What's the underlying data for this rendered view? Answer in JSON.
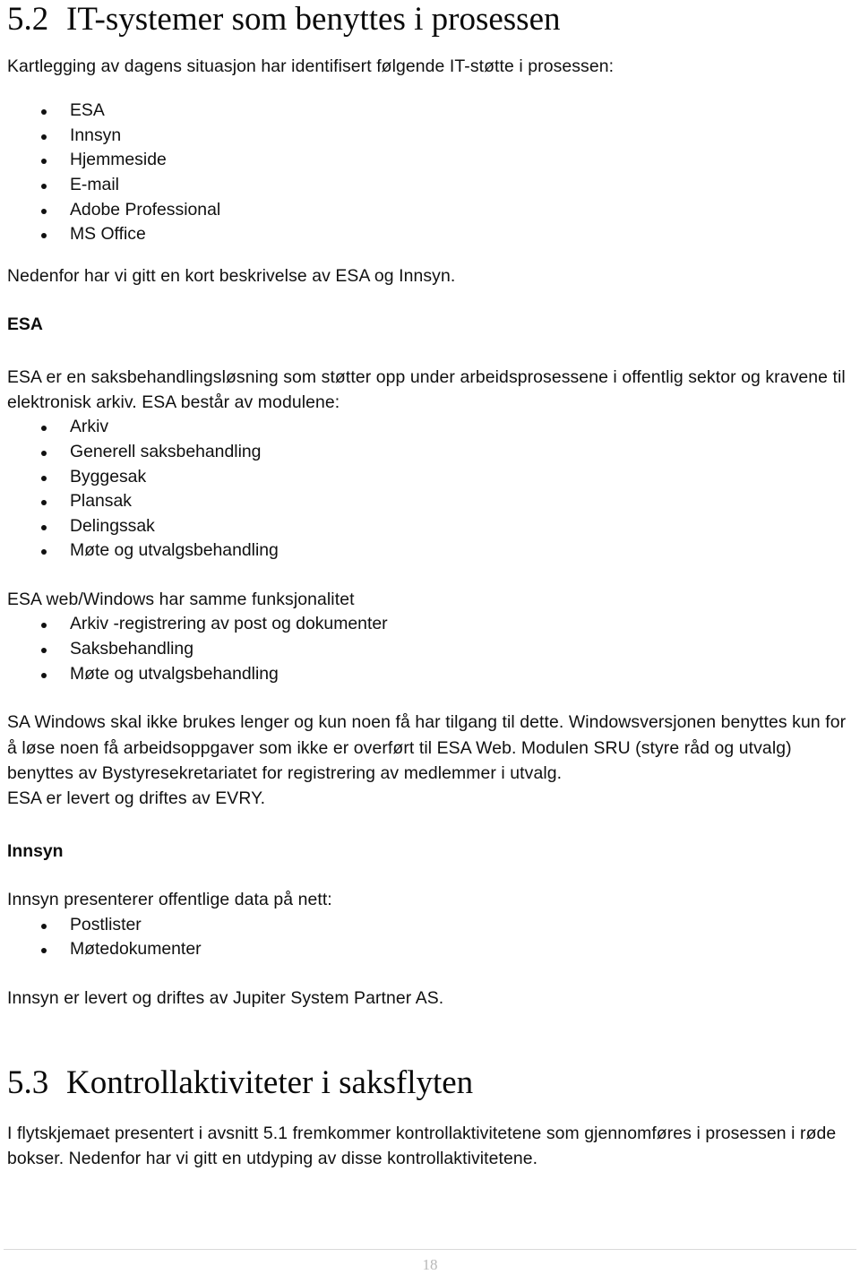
{
  "document": {
    "sections": [
      {
        "number": "5.2",
        "title": "IT-systemer som benyttes i prosessen",
        "intro": "Kartlegging av dagens situasjon har identifisert følgende IT-støtte i prosessen:",
        "systems": [
          "ESA",
          "Innsyn",
          "Hjemmeside",
          "E-mail",
          "Adobe Professional",
          "MS Office"
        ],
        "after_systems": "Nedenfor har vi gitt en kort beskrivelse av ESA og Innsyn.",
        "esa": {
          "heading": "ESA",
          "description": "ESA er en saksbehandlingsløsning som støtter opp under arbeidsprosessene i offentlig sektor og kravene til elektronisk arkiv. ESA består av modulene:",
          "modules": [
            "Arkiv",
            "Generell saksbehandling",
            "Byggesak",
            "Plansak",
            "Delingssak",
            "Møte og utvalgsbehandling"
          ],
          "web_windows_lead": "ESA web/Windows har samme funksjonalitet",
          "web_windows_items": [
            "Arkiv -registrering av post og dokumenter",
            "Saksbehandling",
            "Møte og utvalgsbehandling"
          ],
          "notes": "SA Windows skal ikke brukes lenger og kun noen få har tilgang til dette. Windowsversjonen benyttes kun for å løse noen få arbeidsoppgaver som ikke er overført til ESA Web. Modulen SRU (styre råd og utvalg) benyttes av Bystyresekretariatet for registrering av medlemmer i utvalg.",
          "vendor": "ESA er levert og driftes av EVRY."
        },
        "innsyn": {
          "heading": "Innsyn",
          "description": "Innsyn presenterer offentlige data på nett:",
          "items": [
            "Postlister",
            "Møtedokumenter"
          ],
          "vendor": "Innsyn er levert og driftes av Jupiter System Partner AS."
        }
      },
      {
        "number": "5.3",
        "title": "Kontrollaktiviteter i saksflyten",
        "body": "I flytskjemaet presentert i avsnitt 5.1 fremkommer kontrollaktivitetene som gjennomføres i prosessen i røde bokser. Nedenfor har vi gitt en utdyping av disse kontrollaktivitetene."
      }
    ]
  },
  "footer": {
    "page_number": "18"
  }
}
